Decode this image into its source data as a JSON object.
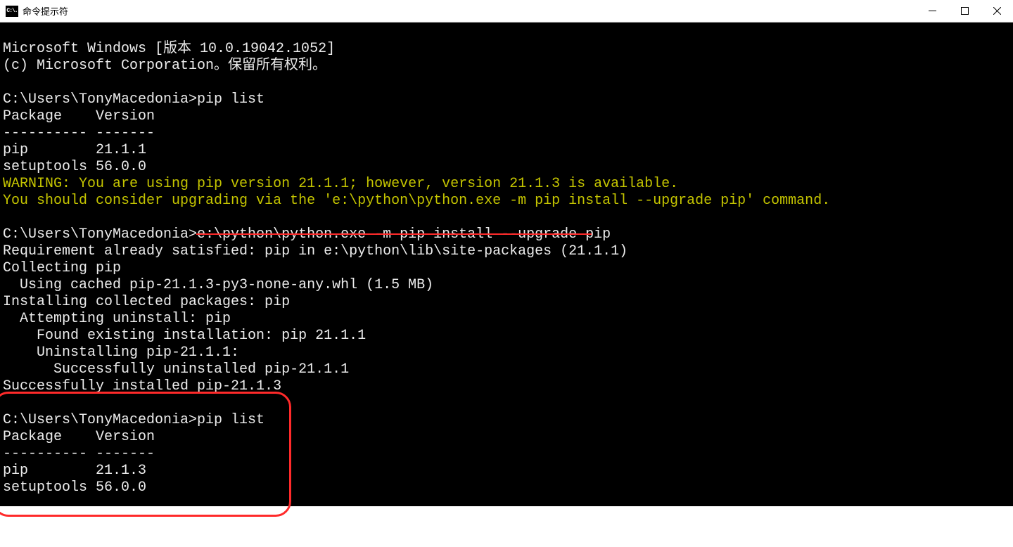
{
  "window": {
    "title": "命令提示符",
    "icon_text": "C:\\."
  },
  "term": {
    "banner1": "Microsoft Windows [版本 10.0.19042.1052]",
    "banner2": "(c) Microsoft Corporation。保留所有权利。",
    "blank": "",
    "prompt1_path": "C:\\Users\\TonyMacedonia>",
    "prompt1_cmd": "pip list",
    "hdr": "Package    Version",
    "rule": "---------- -------",
    "row_pip1": "pip        21.1.1",
    "row_st1": "setuptools 56.0.0",
    "warn1": "WARNING: You are using pip version 21.1.1; however, version 21.1.3 is available.",
    "warn2": "You should consider upgrading via the 'e:\\python\\python.exe -m pip install --upgrade pip' command.",
    "prompt2_path": "C:\\Users\\TonyMacedonia>",
    "prompt2_cmd": "e:\\python\\python.exe -m pip install --upgrade pip",
    "req": "Requirement already satisfied: pip in e:\\python\\lib\\site-packages (21.1.1)",
    "coll": "Collecting pip",
    "cached": "  Using cached pip-21.1.3-py3-none-any.whl (1.5 MB)",
    "inst": "Installing collected packages: pip",
    "att": "  Attempting uninstall: pip",
    "found": "    Found existing installation: pip 21.1.1",
    "unin": "    Uninstalling pip-21.1.1:",
    "succ_un": "      Successfully uninstalled pip-21.1.1",
    "succ_in": "Successfully installed pip-21.1.3",
    "prompt3_path": "C:\\Users\\TonyMacedonia>",
    "prompt3_cmd": "pip list",
    "row_pip2": "pip        21.1.3",
    "row_st2": "setuptools 56.0.0"
  }
}
